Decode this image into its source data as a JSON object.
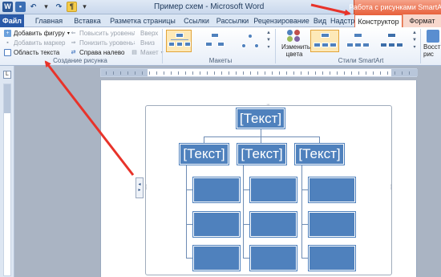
{
  "window": {
    "title": "Пример схем  -  Microsoft Word",
    "contextual_group": "Работа с рисунками SmartArt"
  },
  "quick_access": {
    "app_icon": "W",
    "format_marks_icon": "¶"
  },
  "tabs": [
    {
      "label": "Файл"
    },
    {
      "label": "Главная"
    },
    {
      "label": "Вставка"
    },
    {
      "label": "Разметка страницы"
    },
    {
      "label": "Ссылки"
    },
    {
      "label": "Рассылки"
    },
    {
      "label": "Рецензирование"
    },
    {
      "label": "Вид"
    },
    {
      "label": "Надстройки"
    },
    {
      "label": "Конструктор",
      "active": true
    },
    {
      "label": "Формат"
    }
  ],
  "ribbon": {
    "create_group": {
      "label": "Создание рисунка",
      "add_shape": "Добавить фигуру",
      "add_bullet": "Добавить маркер",
      "text_pane": "Область текста",
      "promote": "Повысить уровень",
      "demote": "Понизить уровень",
      "right_to_left": "Справа налево",
      "move_up": "Вверх",
      "move_down": "Вниз",
      "layout": "Макет"
    },
    "layouts_group": {
      "label": "Макеты"
    },
    "styles_group": {
      "label": "Стили SmartArt",
      "change_colors": "Изменить цвета"
    },
    "reset": {
      "label": "Восст рис"
    }
  },
  "smartart": {
    "top_node": "[Текст]",
    "second_level": [
      "[Текст]",
      "[Текст]",
      "[Текст]"
    ]
  },
  "colors": {
    "node_fill": "#4f81bd",
    "annotation_arrow": "#e8332a",
    "context_tab": "#e8623e"
  }
}
